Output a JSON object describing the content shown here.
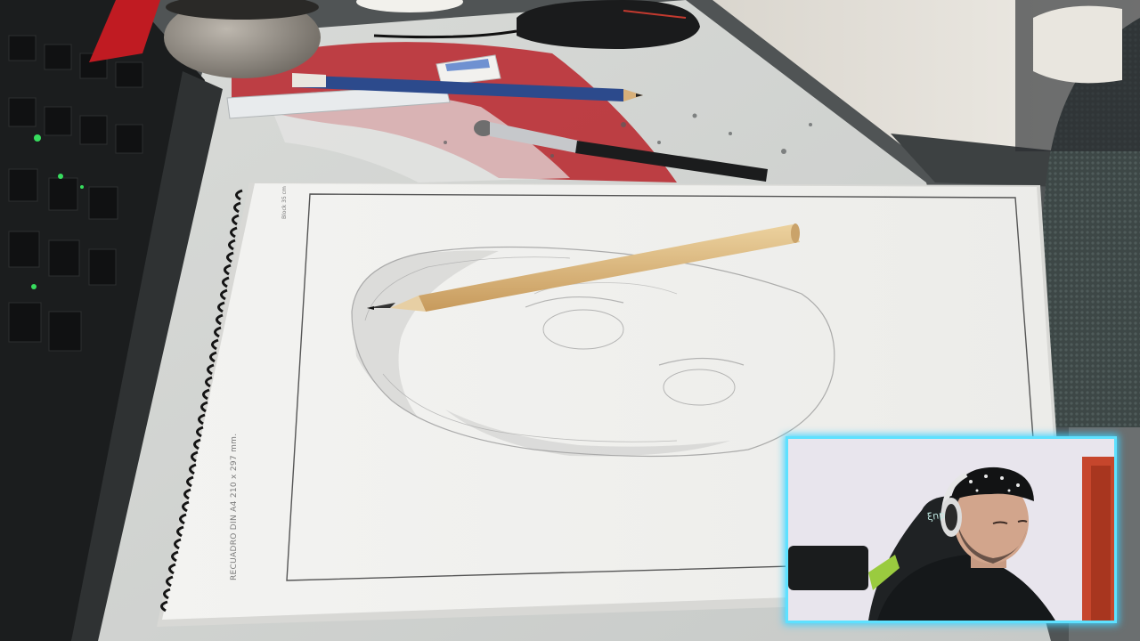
{
  "scene": {
    "description_hidden": "",
    "sheet": {
      "caption": "RECUADRO DIN A4 210 x 297 mm.",
      "corner_text": "Block 35 cm"
    },
    "webcam": {
      "chair_logo": "ξnp"
    }
  },
  "colors": {
    "webcam_border": "#5ee1ff",
    "desk_mat": "#e9ebe8",
    "paper": "#f4f4f2",
    "pencil_wood": "#d9b47c",
    "keyboard_glow": "#3cff6a"
  }
}
